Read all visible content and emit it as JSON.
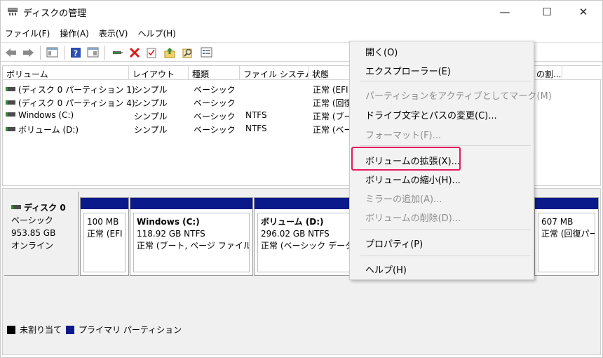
{
  "window": {
    "title": "ディスクの管理",
    "minimize_glyph": "—",
    "maximize_glyph": "☐",
    "close_glyph": "✕"
  },
  "menubar": [
    "ファイル(F)",
    "操作(A)",
    "表示(V)",
    "ヘルプ(H)"
  ],
  "toolbar": {
    "icons": [
      "back-arrow-icon",
      "forward-arrow-icon",
      "console-view-icon",
      "help-icon",
      "properties-view-icon",
      "connect-icon",
      "delete-icon",
      "check-icon",
      "import-icon",
      "search-disk-icon",
      "list-view-icon"
    ],
    "delete_color": "#d61f1f"
  },
  "columns": [
    "ボリューム",
    "レイアウト",
    "種類",
    "ファイル システム",
    "状態",
    "の割..."
  ],
  "volumes": [
    {
      "name": "(ディスク 0 パーティション 1)",
      "layout": "シンプル",
      "type": "ベーシック",
      "fs": "",
      "status": "正常 (EFI"
    },
    {
      "name": "(ディスク 0 パーティション 4)",
      "layout": "シンプル",
      "type": "ベーシック",
      "fs": "",
      "status": "正常 (回復"
    },
    {
      "name": "Windows (C:)",
      "layout": "シンプル",
      "type": "ベーシック",
      "fs": "NTFS",
      "status": "正常 (ブー"
    },
    {
      "name": "ボリューム (D:)",
      "layout": "シンプル",
      "type": "ベーシック",
      "fs": "NTFS",
      "status": "正常 (ベー"
    }
  ],
  "disk": {
    "name": "ディスク 0",
    "kind": "ベーシック",
    "size": "953.85 GB",
    "state": "オンライン"
  },
  "partitions": [
    {
      "name": "",
      "size": "100 MB",
      "desc": "正常 (EFI"
    },
    {
      "name": "Windows  (C:)",
      "size": "118.92 GB NTFS",
      "desc": "正常 (ブート, ページ ファイル, クラ"
    },
    {
      "name": "ボリューム  (D:)",
      "size": "296.02 GB NTFS",
      "desc": "正常 (ベーシック データ パ"
    },
    {
      "name": "",
      "size": "607 MB",
      "desc": "正常 (回復パー"
    }
  ],
  "legend": {
    "unallocated": "未割り当て",
    "primary": "プライマリ パーティション",
    "unallocated_color": "#000000",
    "primary_color": "#0a1a8a"
  },
  "context_menu": {
    "items": [
      {
        "label": "開く(O)",
        "enabled": true
      },
      {
        "label": "エクスプローラー(E)",
        "enabled": true
      },
      {
        "label": "パーティションをアクティブとしてマーク(M)",
        "enabled": false
      },
      {
        "label": "ドライブ文字とパスの変更(C)...",
        "enabled": true
      },
      {
        "label": "フォーマット(F)...",
        "enabled": false
      },
      {
        "label": "ボリュームの拡張(X)...",
        "enabled": true
      },
      {
        "label": "ボリュームの縮小(H)...",
        "enabled": true
      },
      {
        "label": "ミラーの追加(A)...",
        "enabled": false
      },
      {
        "label": "ボリュームの削除(D)...",
        "enabled": false
      },
      {
        "label": "プロパティ(P)",
        "enabled": true
      },
      {
        "label": "ヘルプ(H)",
        "enabled": true
      }
    ],
    "highlight_color": "#e5185a"
  }
}
